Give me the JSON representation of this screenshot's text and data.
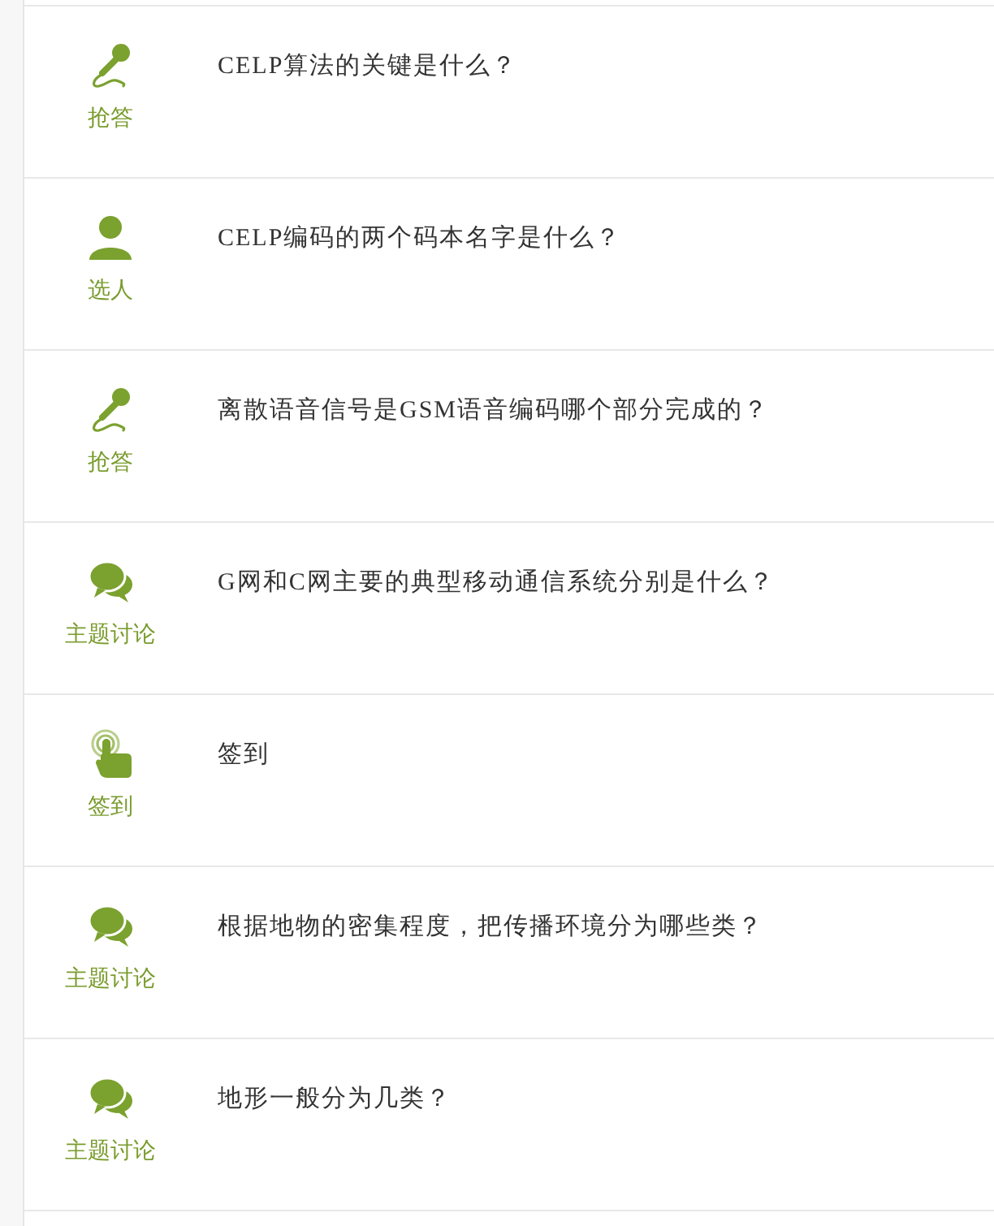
{
  "activities": [
    {
      "kind": "mic",
      "label": "抢答",
      "question": "CELP算法的关键是什么？"
    },
    {
      "kind": "person",
      "label": "选人",
      "question": "CELP编码的两个码本名字是什么？"
    },
    {
      "kind": "mic",
      "label": "抢答",
      "question": "离散语音信号是GSM语音编码哪个部分完成的？"
    },
    {
      "kind": "discussion",
      "label": "主题讨论",
      "question": "G网和C网主要的典型移动通信系统分别是什么？"
    },
    {
      "kind": "checkin",
      "label": "签到",
      "question": "签到"
    },
    {
      "kind": "discussion",
      "label": "主题讨论",
      "question": "根据地物的密集程度，把传播环境分为哪些类？"
    },
    {
      "kind": "discussion",
      "label": "主题讨论",
      "question": "地形一般分为几类？"
    }
  ]
}
